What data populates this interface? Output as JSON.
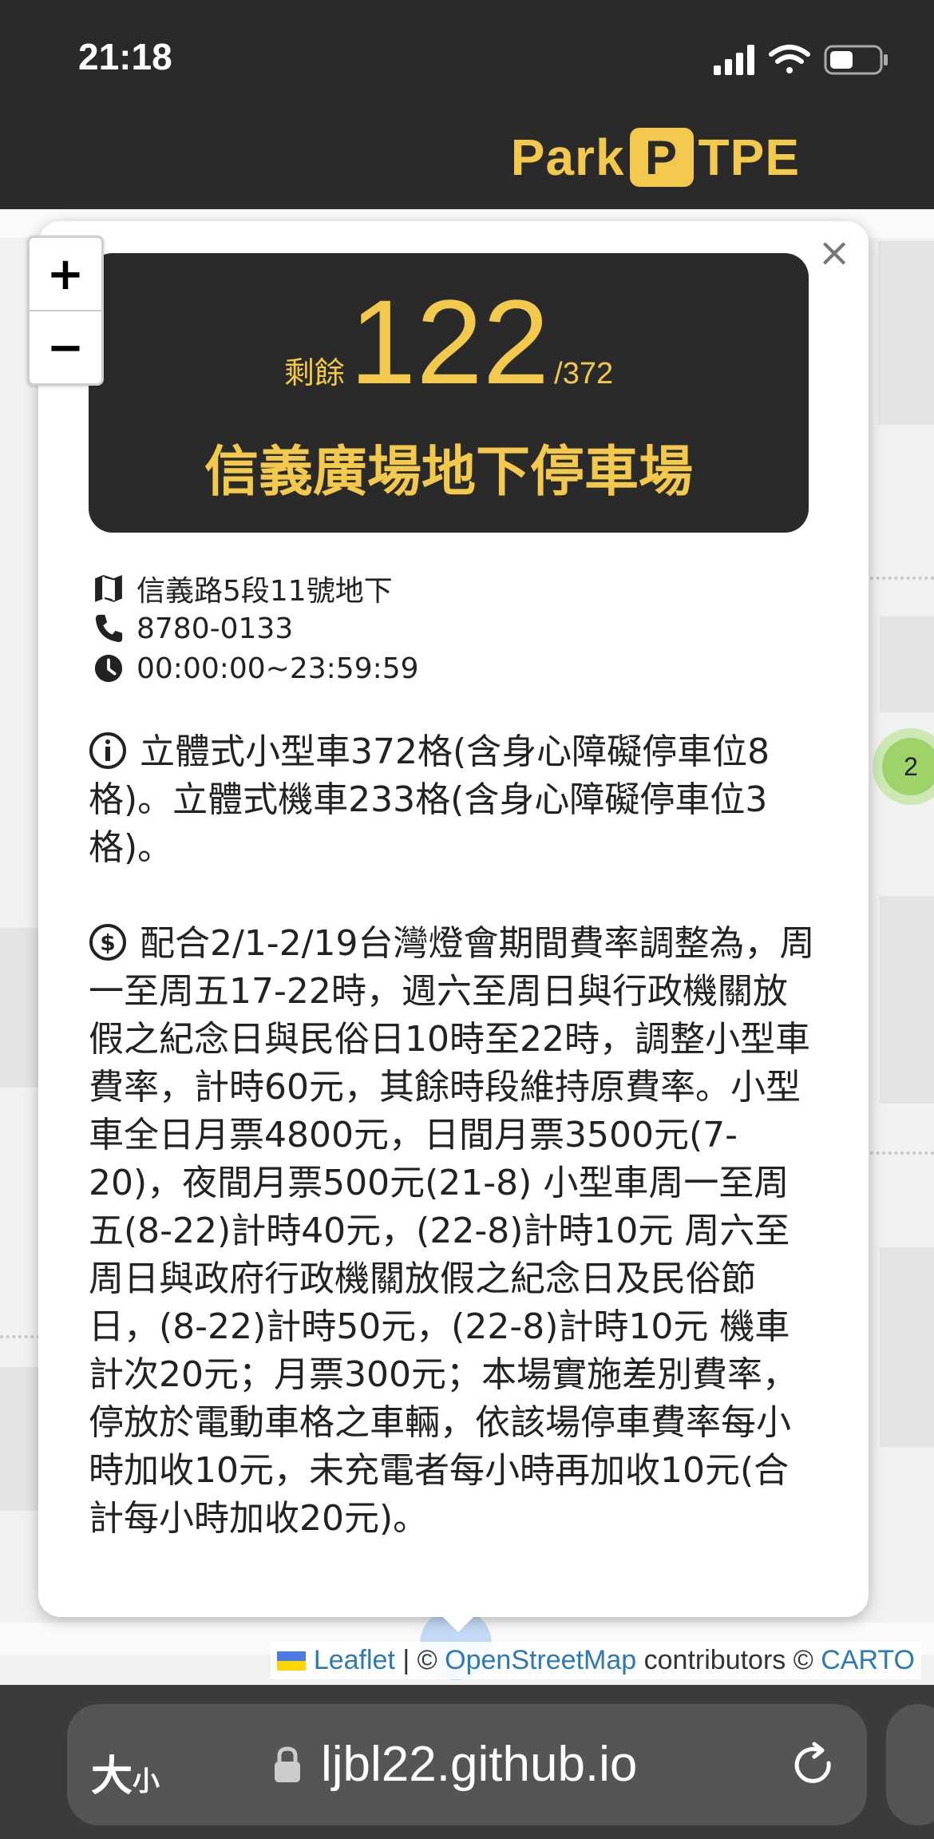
{
  "status_bar": {
    "time": "21:18"
  },
  "header": {
    "logo_left": "Park",
    "logo_badge": "P",
    "logo_right": "TPE"
  },
  "map": {
    "zoom_in": "+",
    "zoom_out": "−",
    "cluster_count": "2",
    "attribution": {
      "leaflet": "Leaflet",
      "sep1": " | © ",
      "osm": "OpenStreetMap",
      "contributors": " contributors © ",
      "carto": "CARTO"
    }
  },
  "popup": {
    "close": "×",
    "available_label": "剩餘",
    "available": "122",
    "total": "/372",
    "name": "信義廣場地下停車場",
    "address": "信義路5段11號地下",
    "phone": "8780-0133",
    "hours": "00:00:00~23:59:59",
    "summary": "立體式小型車372格(含身心障礙停車位8格)。立體式機車233格(含身心障礙停車位3格)。",
    "pay_ex": "配合2/1-2/19台灣燈會期間費率調整為，周一至周五17-22時，週六至周日與行政機關放假之紀念日與民俗日10時至22時，調整小型車費率，計時60元，其餘時段維持原費率。小型車全日月票4800元，日間月票3500元(7-20)，夜間月票500元(21-8) 小型車周一至周五(8-22)計時40元，(22-8)計時10元 周六至周日與政府行政機關放假之紀念日及民俗節日，(8-22)計時50元，(22-8)計時10元 機車計次20元；月票300元；本場實施差別費率，停放於電動車格之車輛，依該場停車費率每小時加收10元，未充電者每小時再加收10元(合計每小時加收20元)。"
  },
  "browser": {
    "text_size_big": "大",
    "text_size_small": "小",
    "url": "ljbl22.github.io"
  },
  "colors": {
    "accent": "#f2c94c",
    "dark": "#2b2a2a",
    "cluster": "#9ed36a",
    "link": "#2e7ab0"
  }
}
